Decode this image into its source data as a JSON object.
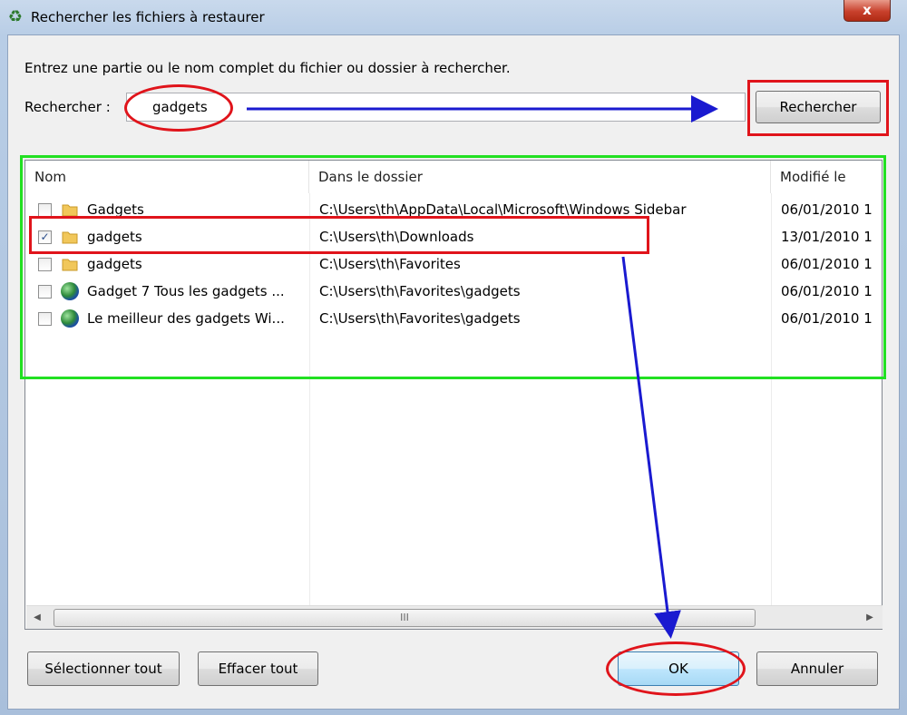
{
  "window": {
    "title": "Rechercher les fichiers à restaurer",
    "close_label": "x"
  },
  "form": {
    "instruction": "Entrez une partie ou le nom complet du fichier ou dossier à rechercher.",
    "search_label": "Rechercher :",
    "search_value": "gadgets",
    "search_button": "Rechercher"
  },
  "list": {
    "columns": [
      "Nom",
      "Dans le dossier",
      "Modifié le"
    ],
    "rows": [
      {
        "checked": false,
        "icon": "folder-icon",
        "name": "Gadgets",
        "folder": "C:\\Users\\th\\AppData\\Local\\Microsoft\\Windows Sidebar",
        "modified": "06/01/2010 1"
      },
      {
        "checked": true,
        "icon": "folder-icon",
        "name": "gadgets",
        "folder": "C:\\Users\\th\\Downloads",
        "modified": "13/01/2010 1"
      },
      {
        "checked": false,
        "icon": "folder-icon",
        "name": "gadgets",
        "folder": "C:\\Users\\th\\Favorites",
        "modified": "06/01/2010 1"
      },
      {
        "checked": false,
        "icon": "globe-icon",
        "name": "Gadget 7  Tous les gadgets ...",
        "folder": "C:\\Users\\th\\Favorites\\gadgets",
        "modified": "06/01/2010 1"
      },
      {
        "checked": false,
        "icon": "globe-icon",
        "name": "Le meilleur des gadgets Wi...",
        "folder": "C:\\Users\\th\\Favorites\\gadgets",
        "modified": "06/01/2010 1"
      }
    ],
    "scroll_grip": "III"
  },
  "buttons": {
    "select_all": "Sélectionner tout",
    "clear_all": "Effacer tout",
    "ok": "OK",
    "cancel": "Annuler"
  },
  "annotation_colors": {
    "highlight": "#e0141b",
    "results_frame": "#22e022",
    "arrow": "#1a1ad0"
  }
}
